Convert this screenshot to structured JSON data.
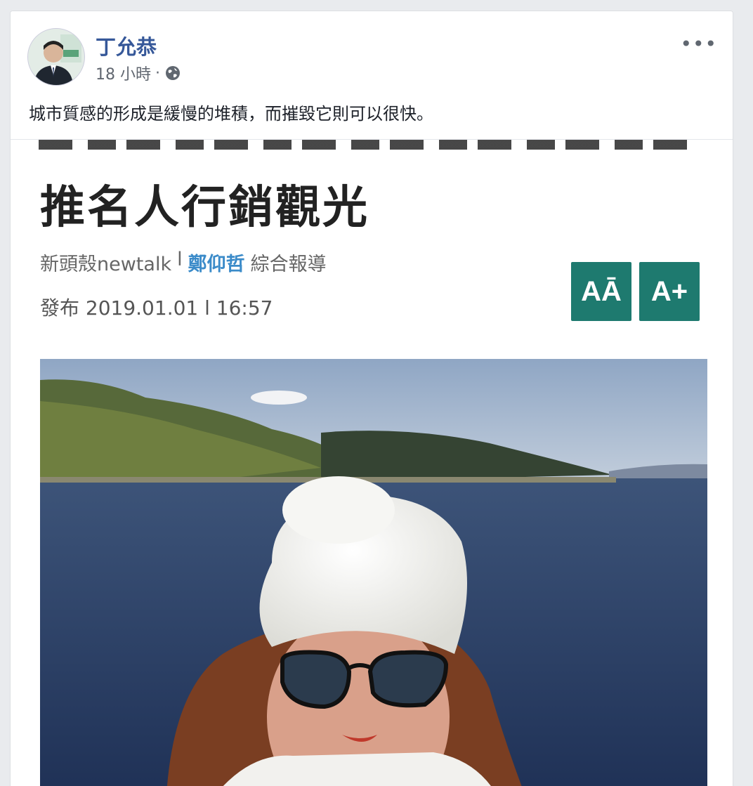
{
  "post": {
    "author": "丁允恭",
    "time": "18 小時",
    "separator": "·",
    "text": "城市質感的形成是緩慢的堆積，而摧毀它則可以很快。"
  },
  "article": {
    "headline": "推名人行銷觀光",
    "source": "新頭殼newtalk",
    "divider": "l",
    "reporter": "鄭仰哲",
    "report_type": "綜合報導",
    "date_label": "發布 2019.01.01 l 16:57",
    "font_decrease": "AĀ",
    "font_increase": "A+"
  },
  "colors": {
    "link": "#365899",
    "accent": "#1e7a6f",
    "reporter": "#3b8bc9"
  }
}
